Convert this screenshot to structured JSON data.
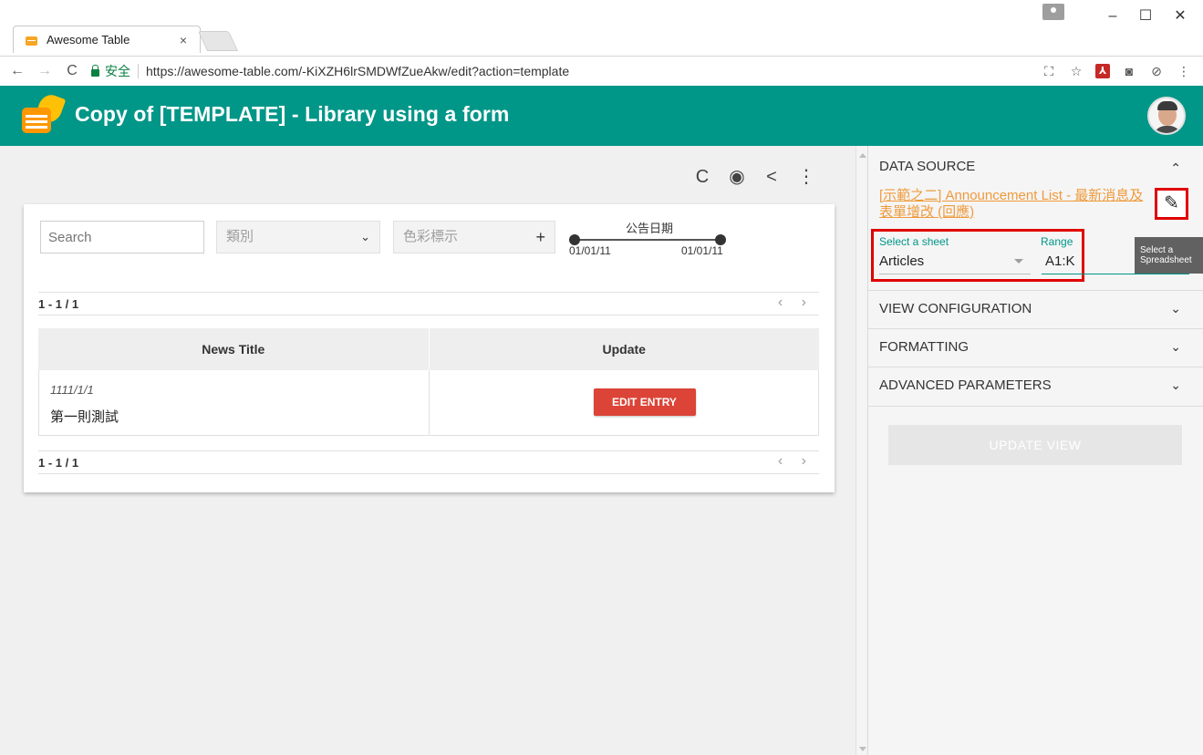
{
  "browser": {
    "tab_title": "Awesome Table",
    "tab_close": "×",
    "secure_label": "安全",
    "url": "https://awesome-table.com/-KiXZH6lrSMDWfZueAkw/edit?action=template",
    "window_min": "–",
    "window_max": "☐",
    "window_close": "✕",
    "nav_back": "←",
    "nav_forward": "→",
    "nav_reload": "C",
    "ext_translate": "⛶",
    "ext_star": "☆",
    "ext_pdf": "⅄",
    "ext_camera": "◙",
    "ext_other": "⊘",
    "ext_menu": "⋮"
  },
  "app": {
    "title": "Copy of [TEMPLATE] - Library using a form"
  },
  "toolbar": {
    "refresh": "C",
    "preview": "◉",
    "share": "<",
    "more": "⋮"
  },
  "filters": {
    "search_placeholder": "Search",
    "category_label": "類別",
    "category_arrow": "⌄",
    "color_label": "色彩標示",
    "color_add": "+",
    "date_label": "公告日期",
    "date_min": "01/01/11",
    "date_max": "01/01/11"
  },
  "pagination": {
    "count": "1 - 1 / 1",
    "nav": "‹ ›"
  },
  "table": {
    "columns": [
      "News Title",
      "Update"
    ],
    "rows": [
      {
        "date": "1111/1/1",
        "title": "第一則測試",
        "action": "EDIT ENTRY"
      }
    ]
  },
  "panel": {
    "data_source": {
      "title": "DATA SOURCE",
      "link": "[示範之二] Announcement List - 最新消息及表單增改 (回應)",
      "sheet_label": "Select a sheet",
      "sheet_value": "Articles",
      "range_label": "Range",
      "range_value": "A1:K",
      "tooltip": "Select a Spreadsheet"
    },
    "sections": [
      "VIEW CONFIGURATION",
      "FORMATTING",
      "ADVANCED PARAMETERS"
    ],
    "chevron_up": "⌃",
    "chevron_down": "⌄",
    "update_button": "UPDATE VIEW",
    "edit_icon": "✎"
  }
}
